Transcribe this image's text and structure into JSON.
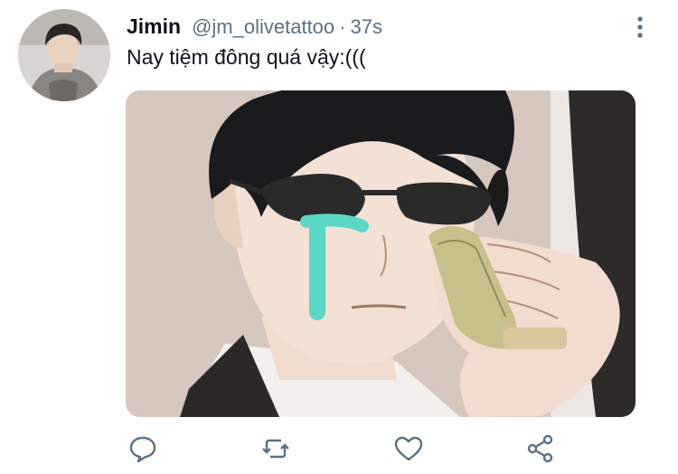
{
  "tweet": {
    "display_name": "Jimin",
    "handle": "@jm_olivetattoo",
    "separator": "·",
    "time": "37s",
    "text": "Nay tiệm đông quá vậy:((("
  },
  "icons": {
    "avatar": "profile-photo",
    "more": "vertical-ellipsis-icon",
    "media": "anime-meme-sunglasses-crying-money",
    "reply": "speech-bubble-icon",
    "retweet": "retweet-arrows-icon",
    "like": "heart-icon",
    "share": "share-nodes-icon"
  },
  "colors": {
    "text": "#0f1419",
    "secondary": "#5b7083",
    "tear": "#59d8c5"
  }
}
